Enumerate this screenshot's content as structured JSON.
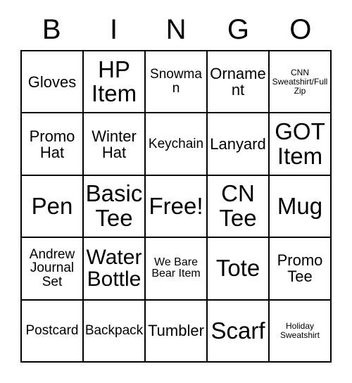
{
  "card": {
    "header": {
      "letters": [
        "B",
        "I",
        "N",
        "G",
        "O"
      ]
    },
    "grid": {
      "rows": [
        {
          "cells": [
            {
              "text": "Gloves",
              "size": "md"
            },
            {
              "text": "HP Item",
              "size": "xl"
            },
            {
              "text": "Snowman",
              "size": "sm"
            },
            {
              "text": "Ornament",
              "size": "md"
            },
            {
              "text": "CNN Sweatshirt/Full Zip",
              "size": "xxs"
            }
          ]
        },
        {
          "cells": [
            {
              "text": "Promo Hat",
              "size": "md"
            },
            {
              "text": "Winter Hat",
              "size": "md"
            },
            {
              "text": "Keychain",
              "size": "sm"
            },
            {
              "text": "Lanyard",
              "size": "md"
            },
            {
              "text": "GOT Item",
              "size": "xl"
            }
          ]
        },
        {
          "cells": [
            {
              "text": "Pen",
              "size": "xl"
            },
            {
              "text": "Basic Tee",
              "size": "xl"
            },
            {
              "text": "Free!",
              "size": "xl"
            },
            {
              "text": "CN Tee",
              "size": "xl"
            },
            {
              "text": "Mug",
              "size": "xl"
            }
          ]
        },
        {
          "cells": [
            {
              "text": "Andrew Journal Set",
              "size": "sm"
            },
            {
              "text": "Water Bottle",
              "size": "lg"
            },
            {
              "text": "We Bare Bear Item",
              "size": "xs"
            },
            {
              "text": "Tote",
              "size": "xl"
            },
            {
              "text": "Promo Tee",
              "size": "md"
            }
          ]
        },
        {
          "cells": [
            {
              "text": "Postcard",
              "size": "sm"
            },
            {
              "text": "Backpack",
              "size": "sm"
            },
            {
              "text": "Tumbler",
              "size": "md"
            },
            {
              "text": "Scarf",
              "size": "xl"
            },
            {
              "text": "Holiday Sweatshirt",
              "size": "xxs"
            }
          ]
        }
      ]
    }
  }
}
